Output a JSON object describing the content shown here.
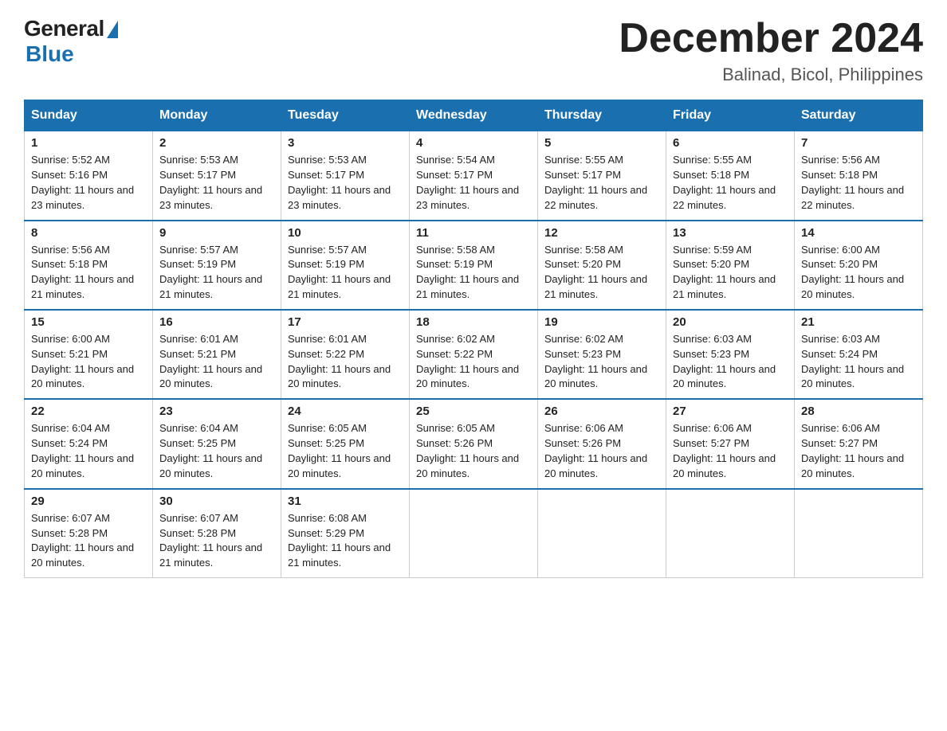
{
  "header": {
    "logo_general": "General",
    "logo_blue": "Blue",
    "month_year": "December 2024",
    "location": "Balinad, Bicol, Philippines"
  },
  "weekdays": [
    "Sunday",
    "Monday",
    "Tuesday",
    "Wednesday",
    "Thursday",
    "Friday",
    "Saturday"
  ],
  "weeks": [
    [
      {
        "day": "1",
        "sunrise": "Sunrise: 5:52 AM",
        "sunset": "Sunset: 5:16 PM",
        "daylight": "Daylight: 11 hours and 23 minutes."
      },
      {
        "day": "2",
        "sunrise": "Sunrise: 5:53 AM",
        "sunset": "Sunset: 5:17 PM",
        "daylight": "Daylight: 11 hours and 23 minutes."
      },
      {
        "day": "3",
        "sunrise": "Sunrise: 5:53 AM",
        "sunset": "Sunset: 5:17 PM",
        "daylight": "Daylight: 11 hours and 23 minutes."
      },
      {
        "day": "4",
        "sunrise": "Sunrise: 5:54 AM",
        "sunset": "Sunset: 5:17 PM",
        "daylight": "Daylight: 11 hours and 23 minutes."
      },
      {
        "day": "5",
        "sunrise": "Sunrise: 5:55 AM",
        "sunset": "Sunset: 5:17 PM",
        "daylight": "Daylight: 11 hours and 22 minutes."
      },
      {
        "day": "6",
        "sunrise": "Sunrise: 5:55 AM",
        "sunset": "Sunset: 5:18 PM",
        "daylight": "Daylight: 11 hours and 22 minutes."
      },
      {
        "day": "7",
        "sunrise": "Sunrise: 5:56 AM",
        "sunset": "Sunset: 5:18 PM",
        "daylight": "Daylight: 11 hours and 22 minutes."
      }
    ],
    [
      {
        "day": "8",
        "sunrise": "Sunrise: 5:56 AM",
        "sunset": "Sunset: 5:18 PM",
        "daylight": "Daylight: 11 hours and 21 minutes."
      },
      {
        "day": "9",
        "sunrise": "Sunrise: 5:57 AM",
        "sunset": "Sunset: 5:19 PM",
        "daylight": "Daylight: 11 hours and 21 minutes."
      },
      {
        "day": "10",
        "sunrise": "Sunrise: 5:57 AM",
        "sunset": "Sunset: 5:19 PM",
        "daylight": "Daylight: 11 hours and 21 minutes."
      },
      {
        "day": "11",
        "sunrise": "Sunrise: 5:58 AM",
        "sunset": "Sunset: 5:19 PM",
        "daylight": "Daylight: 11 hours and 21 minutes."
      },
      {
        "day": "12",
        "sunrise": "Sunrise: 5:58 AM",
        "sunset": "Sunset: 5:20 PM",
        "daylight": "Daylight: 11 hours and 21 minutes."
      },
      {
        "day": "13",
        "sunrise": "Sunrise: 5:59 AM",
        "sunset": "Sunset: 5:20 PM",
        "daylight": "Daylight: 11 hours and 21 minutes."
      },
      {
        "day": "14",
        "sunrise": "Sunrise: 6:00 AM",
        "sunset": "Sunset: 5:20 PM",
        "daylight": "Daylight: 11 hours and 20 minutes."
      }
    ],
    [
      {
        "day": "15",
        "sunrise": "Sunrise: 6:00 AM",
        "sunset": "Sunset: 5:21 PM",
        "daylight": "Daylight: 11 hours and 20 minutes."
      },
      {
        "day": "16",
        "sunrise": "Sunrise: 6:01 AM",
        "sunset": "Sunset: 5:21 PM",
        "daylight": "Daylight: 11 hours and 20 minutes."
      },
      {
        "day": "17",
        "sunrise": "Sunrise: 6:01 AM",
        "sunset": "Sunset: 5:22 PM",
        "daylight": "Daylight: 11 hours and 20 minutes."
      },
      {
        "day": "18",
        "sunrise": "Sunrise: 6:02 AM",
        "sunset": "Sunset: 5:22 PM",
        "daylight": "Daylight: 11 hours and 20 minutes."
      },
      {
        "day": "19",
        "sunrise": "Sunrise: 6:02 AM",
        "sunset": "Sunset: 5:23 PM",
        "daylight": "Daylight: 11 hours and 20 minutes."
      },
      {
        "day": "20",
        "sunrise": "Sunrise: 6:03 AM",
        "sunset": "Sunset: 5:23 PM",
        "daylight": "Daylight: 11 hours and 20 minutes."
      },
      {
        "day": "21",
        "sunrise": "Sunrise: 6:03 AM",
        "sunset": "Sunset: 5:24 PM",
        "daylight": "Daylight: 11 hours and 20 minutes."
      }
    ],
    [
      {
        "day": "22",
        "sunrise": "Sunrise: 6:04 AM",
        "sunset": "Sunset: 5:24 PM",
        "daylight": "Daylight: 11 hours and 20 minutes."
      },
      {
        "day": "23",
        "sunrise": "Sunrise: 6:04 AM",
        "sunset": "Sunset: 5:25 PM",
        "daylight": "Daylight: 11 hours and 20 minutes."
      },
      {
        "day": "24",
        "sunrise": "Sunrise: 6:05 AM",
        "sunset": "Sunset: 5:25 PM",
        "daylight": "Daylight: 11 hours and 20 minutes."
      },
      {
        "day": "25",
        "sunrise": "Sunrise: 6:05 AM",
        "sunset": "Sunset: 5:26 PM",
        "daylight": "Daylight: 11 hours and 20 minutes."
      },
      {
        "day": "26",
        "sunrise": "Sunrise: 6:06 AM",
        "sunset": "Sunset: 5:26 PM",
        "daylight": "Daylight: 11 hours and 20 minutes."
      },
      {
        "day": "27",
        "sunrise": "Sunrise: 6:06 AM",
        "sunset": "Sunset: 5:27 PM",
        "daylight": "Daylight: 11 hours and 20 minutes."
      },
      {
        "day": "28",
        "sunrise": "Sunrise: 6:06 AM",
        "sunset": "Sunset: 5:27 PM",
        "daylight": "Daylight: 11 hours and 20 minutes."
      }
    ],
    [
      {
        "day": "29",
        "sunrise": "Sunrise: 6:07 AM",
        "sunset": "Sunset: 5:28 PM",
        "daylight": "Daylight: 11 hours and 20 minutes."
      },
      {
        "day": "30",
        "sunrise": "Sunrise: 6:07 AM",
        "sunset": "Sunset: 5:28 PM",
        "daylight": "Daylight: 11 hours and 21 minutes."
      },
      {
        "day": "31",
        "sunrise": "Sunrise: 6:08 AM",
        "sunset": "Sunset: 5:29 PM",
        "daylight": "Daylight: 11 hours and 21 minutes."
      },
      null,
      null,
      null,
      null
    ]
  ]
}
